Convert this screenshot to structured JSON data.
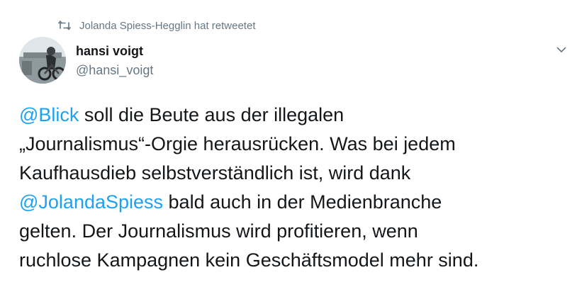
{
  "retweet": {
    "icon": "retweet-icon",
    "text": "Jolanda Spiess-Hegglin hat retweetet"
  },
  "author": {
    "display_name": "hansi voigt",
    "handle": "@hansi_voigt",
    "avatar": "avatar-photo"
  },
  "menu": {
    "icon": "chevron-down-icon"
  },
  "tweet": {
    "line1": {
      "mention": "@Blick",
      "text": " soll die Beute aus der illegalen"
    },
    "line2": "„Journalismus“-Orgie herausrücken. Was bei jedem",
    "line3": "Kaufhausdieb selbstverständlich ist, wird dank",
    "line4": {
      "mention": "@JolandaSpiess",
      "text": " bald auch in der Medienbranche"
    },
    "line5": "gelten. Der Journalismus wird profitieren, wenn",
    "line6": "ruchlose Kampagnen kein Geschäftsmodel mehr sind."
  },
  "colors": {
    "link": "#1da1f2",
    "text": "#14171a",
    "secondary": "#657786"
  }
}
